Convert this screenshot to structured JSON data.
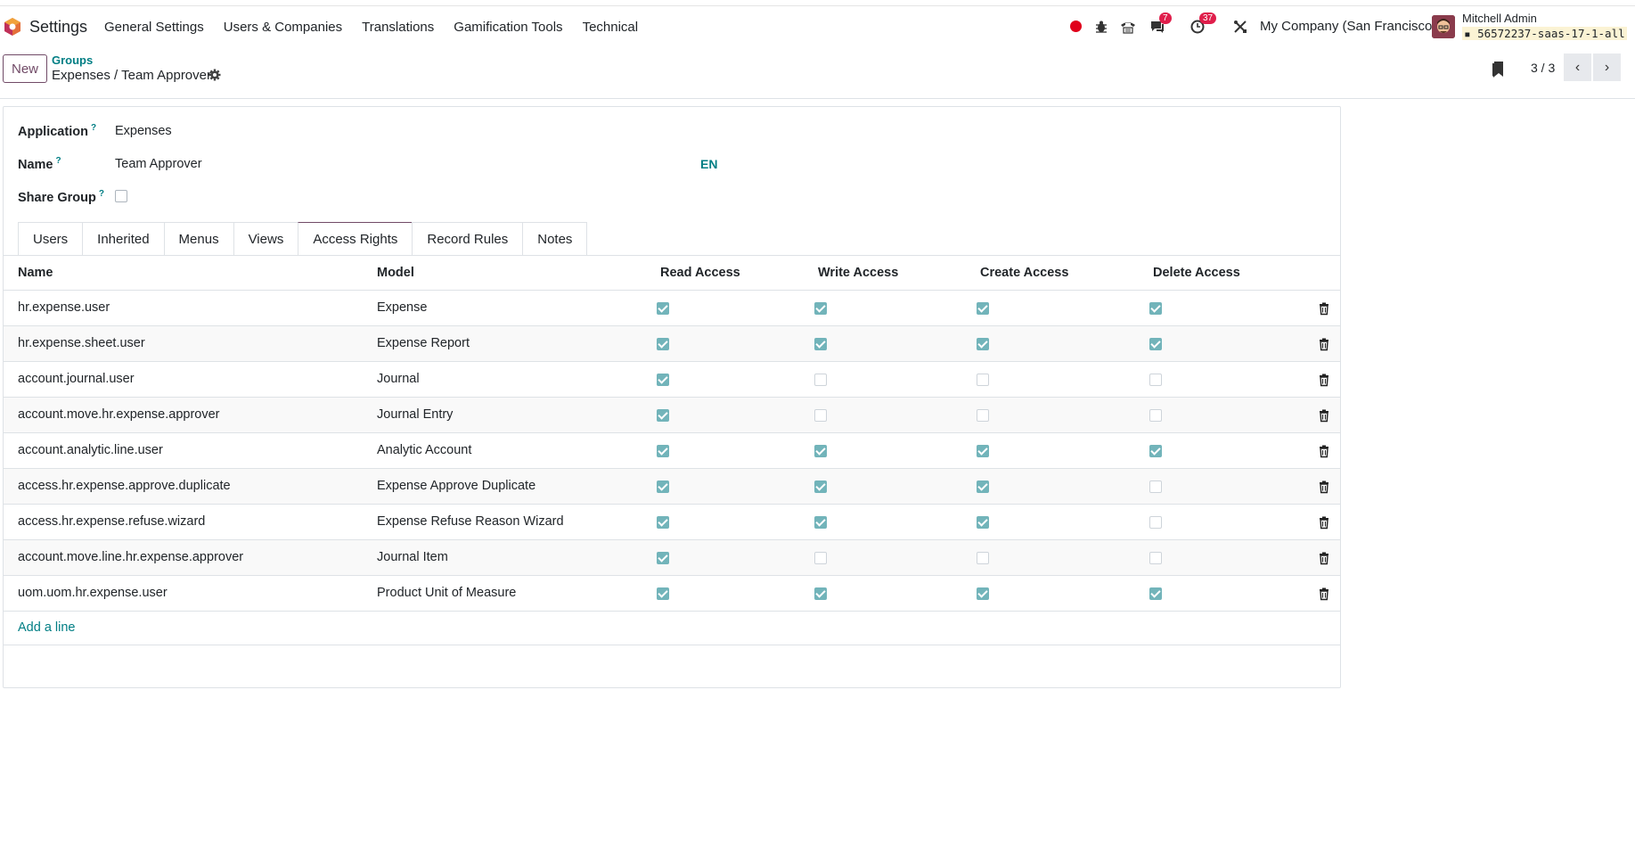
{
  "app": {
    "name": "Settings"
  },
  "menu": [
    "General Settings",
    "Users & Companies",
    "Translations",
    "Gamification Tools",
    "Technical"
  ],
  "systray": {
    "messages_count": "7",
    "activities_count": "37"
  },
  "user": {
    "company": "My Company (San Francisco)",
    "name": "Mitchell Admin",
    "db": "56572237-saas-17-1-all"
  },
  "control": {
    "new_label": "New",
    "breadcrumb": "Groups",
    "title": "Expenses / Team Approver",
    "pager": "3 / 3"
  },
  "form": {
    "application_label": "Application",
    "application_value": "Expenses",
    "name_label": "Name",
    "name_value": "Team Approver",
    "lang": "EN",
    "share_label": "Share Group",
    "help_mark": "?"
  },
  "tabs": [
    {
      "label": "Users",
      "active": false
    },
    {
      "label": "Inherited",
      "active": false
    },
    {
      "label": "Menus",
      "active": false
    },
    {
      "label": "Views",
      "active": false
    },
    {
      "label": "Access Rights",
      "active": true
    },
    {
      "label": "Record Rules",
      "active": false
    },
    {
      "label": "Notes",
      "active": false
    }
  ],
  "table": {
    "headers": [
      "Name",
      "Model",
      "Read Access",
      "Write Access",
      "Create Access",
      "Delete Access"
    ],
    "rows": [
      {
        "name": "hr.expense.user",
        "model": "Expense",
        "read": true,
        "write": true,
        "create": true,
        "delete": true
      },
      {
        "name": "hr.expense.sheet.user",
        "model": "Expense Report",
        "read": true,
        "write": true,
        "create": true,
        "delete": true
      },
      {
        "name": "account.journal.user",
        "model": "Journal",
        "read": true,
        "write": false,
        "create": false,
        "delete": false
      },
      {
        "name": "account.move.hr.expense.approver",
        "model": "Journal Entry",
        "read": true,
        "write": false,
        "create": false,
        "delete": false
      },
      {
        "name": "account.analytic.line.user",
        "model": "Analytic Account",
        "read": true,
        "write": true,
        "create": true,
        "delete": true
      },
      {
        "name": "access.hr.expense.approve.duplicate",
        "model": "Expense Approve Duplicate",
        "read": true,
        "write": true,
        "create": true,
        "delete": false
      },
      {
        "name": "access.hr.expense.refuse.wizard",
        "model": "Expense Refuse Reason Wizard",
        "read": true,
        "write": true,
        "create": true,
        "delete": false
      },
      {
        "name": "account.move.line.hr.expense.approver",
        "model": "Journal Item",
        "read": true,
        "write": false,
        "create": false,
        "delete": false
      },
      {
        "name": "uom.uom.hr.expense.user",
        "model": "Product Unit of Measure",
        "read": true,
        "write": true,
        "create": true,
        "delete": true
      }
    ],
    "add_line": "Add a line"
  },
  "colors": {
    "accent": "#714b67",
    "link": "#017e84",
    "checkbox_on": "#72b4ba",
    "badge": "#e01e4b"
  }
}
